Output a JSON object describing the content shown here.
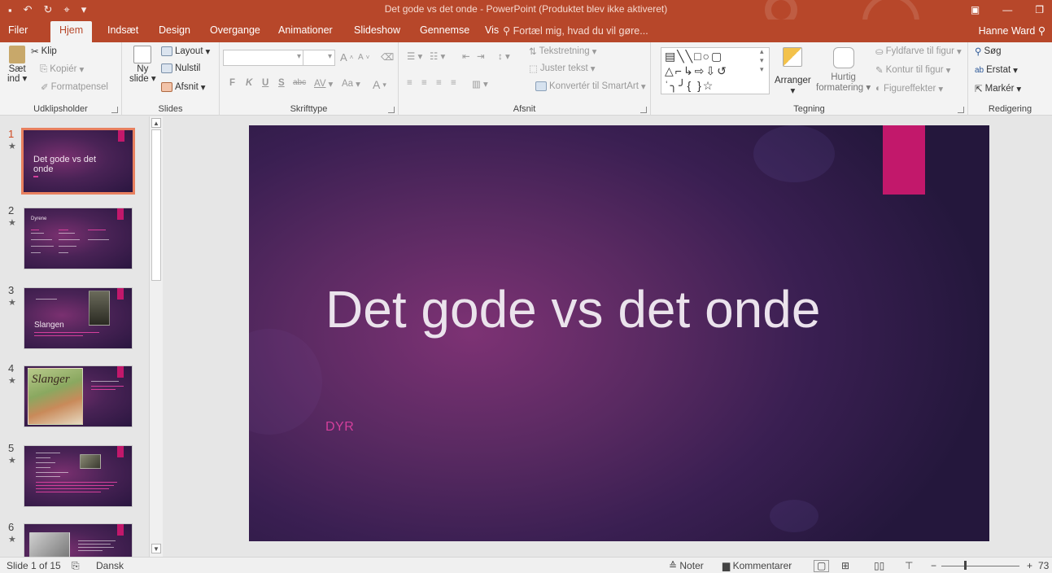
{
  "app": {
    "title": "Det gode vs det onde - PowerPoint (Produktet blev ikke aktiveret)",
    "user": "Hanne Ward",
    "accent": "#b7472a"
  },
  "tabs": [
    {
      "label": "Filer",
      "active": false
    },
    {
      "label": "Hjem",
      "active": true
    },
    {
      "label": "Indsæt",
      "active": false
    },
    {
      "label": "Design",
      "active": false
    },
    {
      "label": "Overgange",
      "active": false
    },
    {
      "label": "Animationer",
      "active": false
    },
    {
      "label": "Slideshow",
      "active": false
    },
    {
      "label": "Gennemse",
      "active": false
    },
    {
      "label": "Vis",
      "active": false
    }
  ],
  "tell_me": "Fortæl mig, hvad du vil gøre...",
  "ribbon": {
    "clipboard": {
      "label": "Udklipsholder",
      "paste_line1": "Sæt",
      "paste_line2": "ind",
      "cut": "Klip",
      "copy": "Kopiér",
      "format_painter": "Formatpensel"
    },
    "slides": {
      "label": "Slides",
      "new_slide_line1": "Ny",
      "new_slide_line2": "slide",
      "layout": "Layout",
      "reset": "Nulstil",
      "section": "Afsnit"
    },
    "font": {
      "label": "Skrifttype",
      "bold": "F",
      "italic": "K",
      "underline": "U",
      "shadow": "S",
      "strike": "abc",
      "spacing": "AV",
      "case": "Aa",
      "color": "A",
      "grow": "A",
      "shrink": "A"
    },
    "paragraph": {
      "label": "Afsnit",
      "text_direction": "Tekstretning",
      "align_text": "Juster tekst",
      "smartart": "Konvertér til SmartArt"
    },
    "drawing": {
      "label": "Tegning",
      "arrange": "Arranger",
      "quick_line1": "Hurtig",
      "quick_line2": "formatering",
      "fill": "Fyldfarve til figur",
      "outline": "Kontur til figur",
      "effects": "Figureffekter"
    },
    "editing": {
      "label": "Redigering",
      "find": "Søg",
      "replace": "Erstat",
      "select": "Markér"
    }
  },
  "thumbnails": [
    {
      "number": "1",
      "title": "Det gode vs det onde",
      "selected": true
    },
    {
      "number": "2",
      "title": "Dyrene",
      "selected": false
    },
    {
      "number": "3",
      "title": "Slangen",
      "selected": false
    },
    {
      "number": "4",
      "title": "Slanger",
      "selected": false
    },
    {
      "number": "5",
      "title": "",
      "selected": false
    },
    {
      "number": "6",
      "title": "",
      "selected": false
    }
  ],
  "slide": {
    "title": "Det gode vs det onde",
    "subtitle": "DYR",
    "accent": "#c2186b"
  },
  "status": {
    "slide_info": "Slide 1 of 15",
    "language": "Dansk",
    "notes": "Noter",
    "comments": "Kommentarer",
    "zoom": "73"
  }
}
